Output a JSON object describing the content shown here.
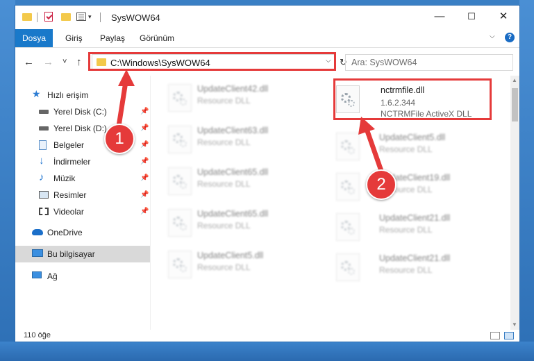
{
  "window": {
    "title": "SysWOW64",
    "controls": {
      "minimize": "—",
      "maximize": "☐",
      "close": "✕"
    }
  },
  "ribbon": {
    "tabs": [
      "Dosya",
      "Giriş",
      "Paylaş",
      "Görünüm"
    ],
    "help": "?"
  },
  "nav": {
    "back": "←",
    "forward": "→",
    "recent": "˅",
    "up": "↑",
    "address": "C:\\Windows\\SysWOW64",
    "search_placeholder": "Ara: SysWOW64"
  },
  "sidebar": {
    "items": [
      {
        "label": "Hızlı erişim",
        "icon": "star-icon"
      },
      {
        "label": "Yerel Disk (C:)",
        "icon": "drive-icon"
      },
      {
        "label": "Yerel Disk (D:)",
        "icon": "drive-icon"
      },
      {
        "label": "Belgeler",
        "icon": "documents-icon"
      },
      {
        "label": "İndirmeler",
        "icon": "downloads-icon"
      },
      {
        "label": "Müzik",
        "icon": "music-icon"
      },
      {
        "label": "Resimler",
        "icon": "pictures-icon"
      },
      {
        "label": "Videolar",
        "icon": "videos-icon"
      },
      {
        "label": "OneDrive",
        "icon": "cloud-icon"
      },
      {
        "label": "Bu bilgisayar",
        "icon": "computer-icon"
      },
      {
        "label": "Ağ",
        "icon": "network-icon"
      }
    ]
  },
  "files": {
    "left": [
      {
        "name": "UpdateClient42.dll",
        "type": "Resource DLL"
      },
      {
        "name": "UpdateClient63.dll",
        "type": "Resource DLL"
      },
      {
        "name": "UpdateClient65.dll",
        "type": "Resource DLL"
      },
      {
        "name": "UpdateClient65.dll",
        "type": "Resource DLL"
      },
      {
        "name": "UpdateClient5.dll",
        "type": "Resource DLL"
      }
    ],
    "right": [
      {
        "name": "nctrmfile.dll",
        "version": "1.6.2.344",
        "type": "NCTRMFile ActiveX DLL"
      },
      {
        "name": "UpdateClient5.dll",
        "type": "Resource DLL"
      },
      {
        "name": "UpdateClient19.dll",
        "type": "Resource DLL"
      },
      {
        "name": "UpdateClient21.dll",
        "type": "Resource DLL"
      },
      {
        "name": "UpdateClient21.dll",
        "type": "Resource DLL"
      }
    ]
  },
  "status": {
    "count": "110 öğe"
  },
  "annotations": {
    "step1": "1",
    "step2": "2",
    "color": "#e53a3a"
  }
}
